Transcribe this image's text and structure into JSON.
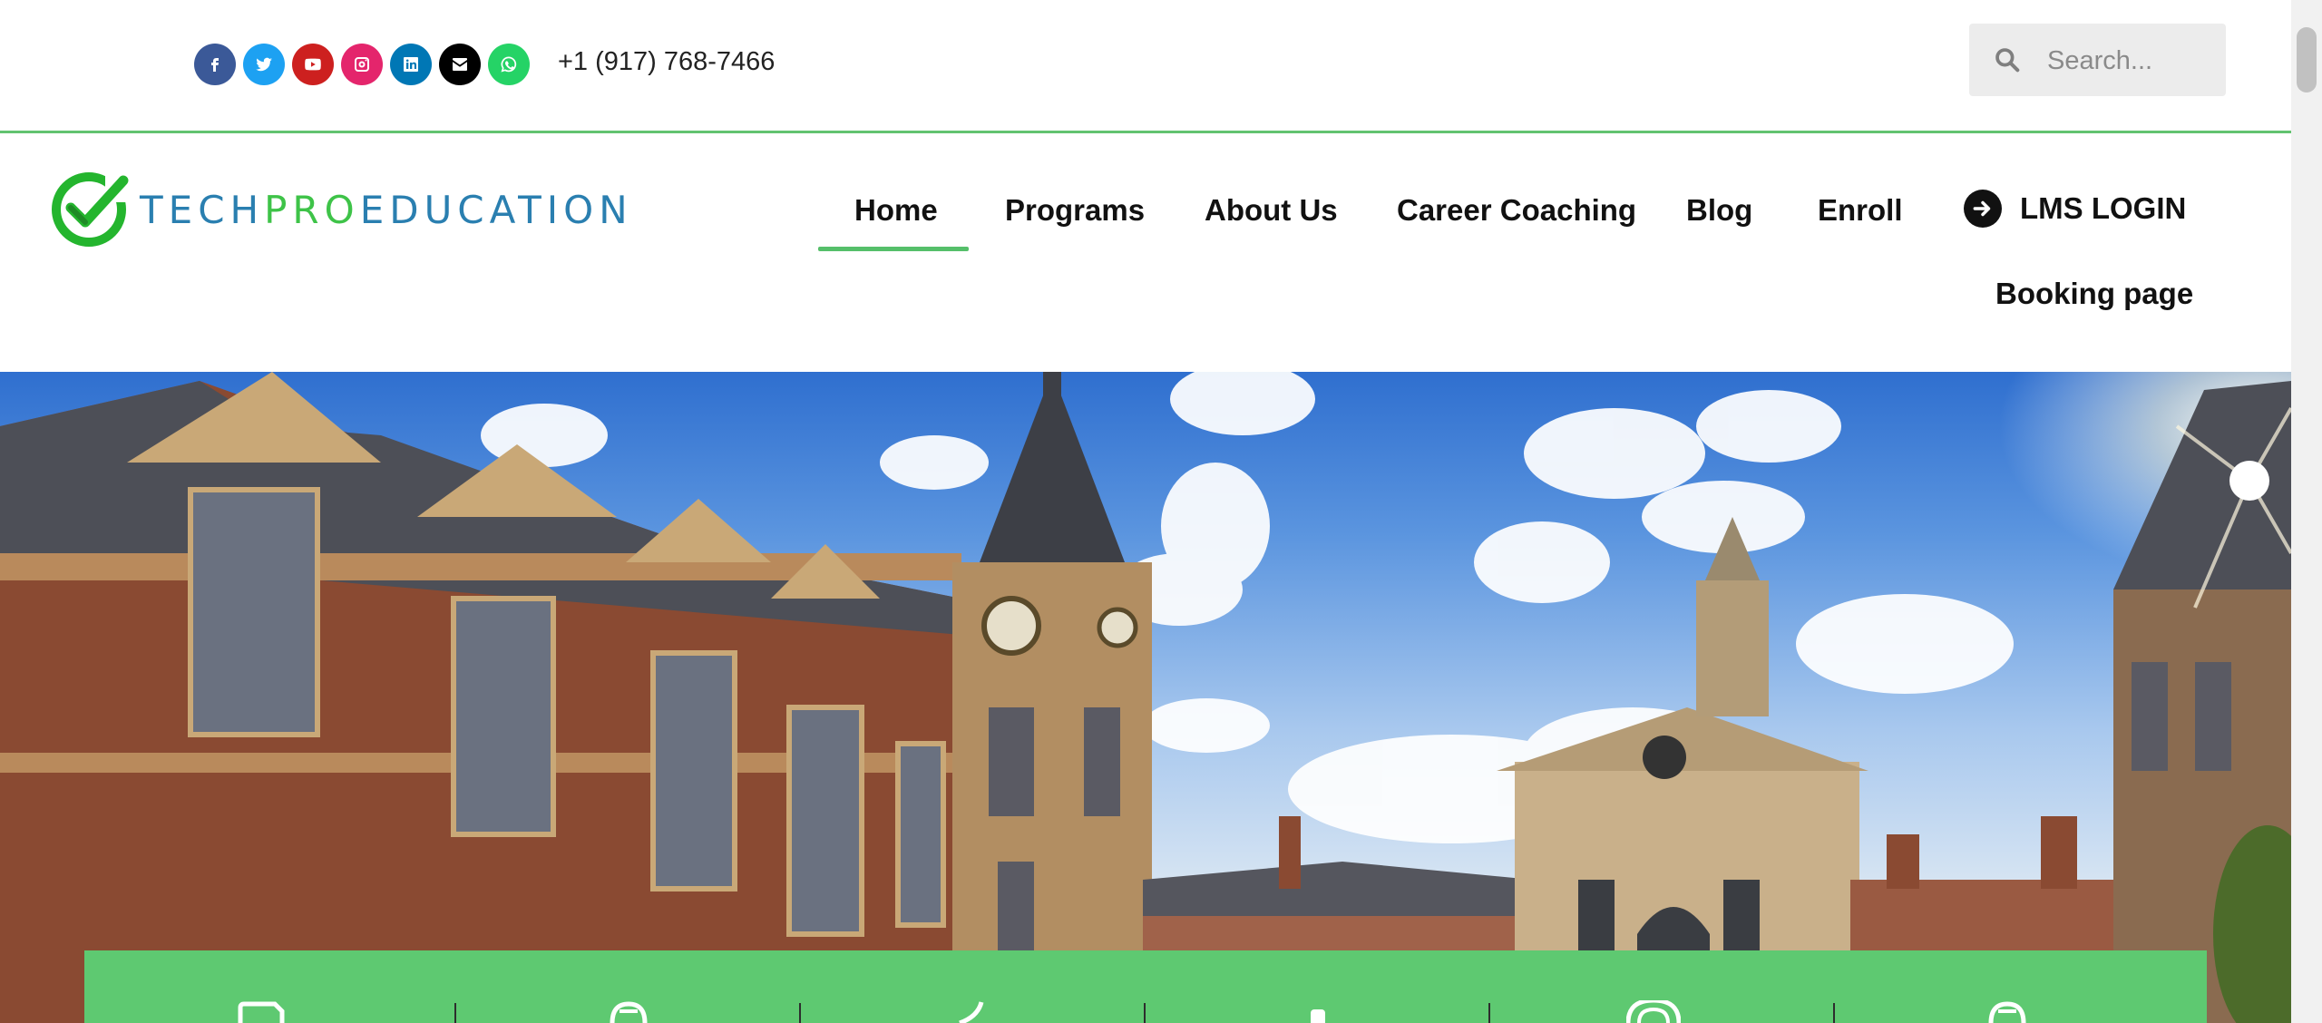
{
  "topbar": {
    "socials": [
      {
        "icon": "facebook-icon",
        "color": "#3b5998"
      },
      {
        "icon": "twitter-icon",
        "color": "#1da1f2"
      },
      {
        "icon": "youtube-icon",
        "color": "#cd201f"
      },
      {
        "icon": "instagram-icon",
        "color": "#e4256c"
      },
      {
        "icon": "linkedin-icon",
        "color": "#0077b5"
      },
      {
        "icon": "envelope-icon",
        "color": "#000000"
      },
      {
        "icon": "whatsapp-icon",
        "color": "#25d366"
      }
    ],
    "phone": "+1 (917) 768-7466",
    "search": {
      "placeholder": "Search...",
      "value": "",
      "icon": "search-icon"
    }
  },
  "header": {
    "logo": {
      "part1": "TECH",
      "part2": "PRO",
      "part3": "EDUCATION",
      "icon": "checkmark-logo-icon"
    },
    "nav": [
      {
        "label": "Home",
        "active": true
      },
      {
        "label": "Programs"
      },
      {
        "label": "About Us"
      },
      {
        "label": "Career Coaching"
      },
      {
        "label": "Blog"
      },
      {
        "label": "Enroll"
      }
    ],
    "lms_login": {
      "label": "LMS LOGIN",
      "icon": "arrow-right-circle-icon"
    },
    "booking": "Booking page"
  },
  "hero": {
    "image": "college-campus-photo",
    "feature_bar_color": "#5ec971"
  },
  "colors": {
    "accent": "#62c370",
    "logo_blue": "#2a7fb0",
    "logo_green": "#3ec348"
  }
}
